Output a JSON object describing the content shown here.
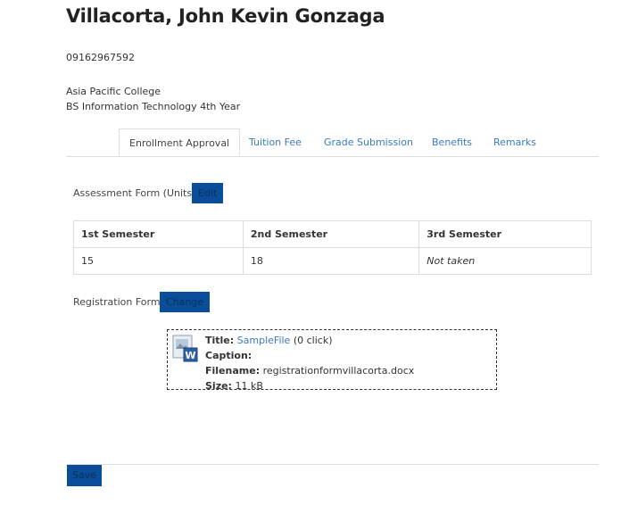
{
  "profile": {
    "name": "Villacorta, John Kevin Gonzaga",
    "phone": "09162967592",
    "school": "Asia Pacific College",
    "program": "BS Information Technology 4th Year"
  },
  "tabs": [
    {
      "label": "Enrollment Approval",
      "active": true
    },
    {
      "label": "Tuition Fee",
      "active": false
    },
    {
      "label": "Grade Submission",
      "active": false
    },
    {
      "label": "Benefits",
      "active": false
    },
    {
      "label": "Remarks",
      "active": false
    }
  ],
  "assessment": {
    "label": "Assessment Form (Units)",
    "edit_label": "Edit",
    "headers": [
      "1st Semester",
      "2nd Semester",
      "3rd Semester"
    ],
    "values": [
      "15",
      "18",
      "Not taken"
    ]
  },
  "registration": {
    "label": "Registration Form",
    "change_label": "Change",
    "file": {
      "title_label": "Title:",
      "title_link": "SampleFile",
      "clicks": "(0 click)",
      "caption_label": "Caption:",
      "caption_value": "",
      "filename_label": "Filename:",
      "filename_value": "registrationformvillacorta.docx",
      "size_label": "Size:",
      "size_value": "11 kB",
      "icon": "word-document-icon"
    }
  },
  "footer": {
    "save_label": "Save"
  },
  "colors": {
    "button_bg": "#0a4e9a",
    "link": "#3a7bbf",
    "border": "#dddddd"
  }
}
